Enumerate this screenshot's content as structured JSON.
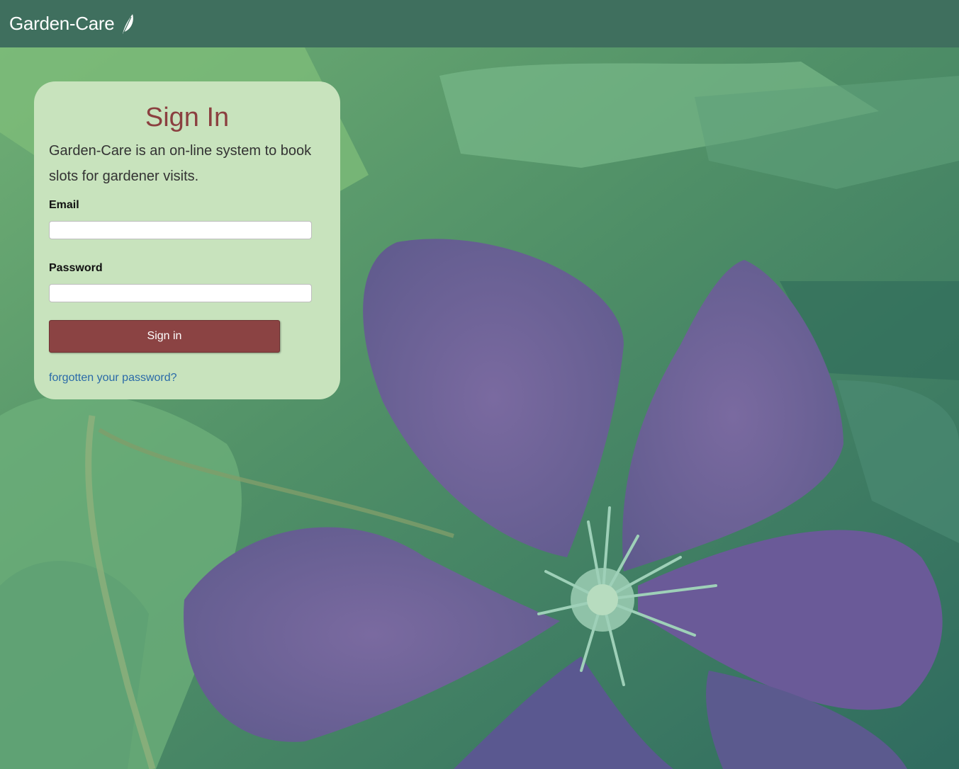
{
  "navbar": {
    "brand": "Garden-Care",
    "brand_icon": "leaf-icon",
    "background": "#3f6f5e"
  },
  "signin_card": {
    "title": "Sign In",
    "intro": "Garden-Care is an on-line system to book slots for gardener visits.",
    "email_label": "Email",
    "email_value": "",
    "password_label": "Password",
    "password_value": "",
    "submit_label": "Sign in",
    "forgot_link": "forgotten your password?",
    "background": "#c8e3bd",
    "title_color": "#8b4040",
    "button_color": "#8b4343",
    "link_color": "#2a6aa8"
  }
}
